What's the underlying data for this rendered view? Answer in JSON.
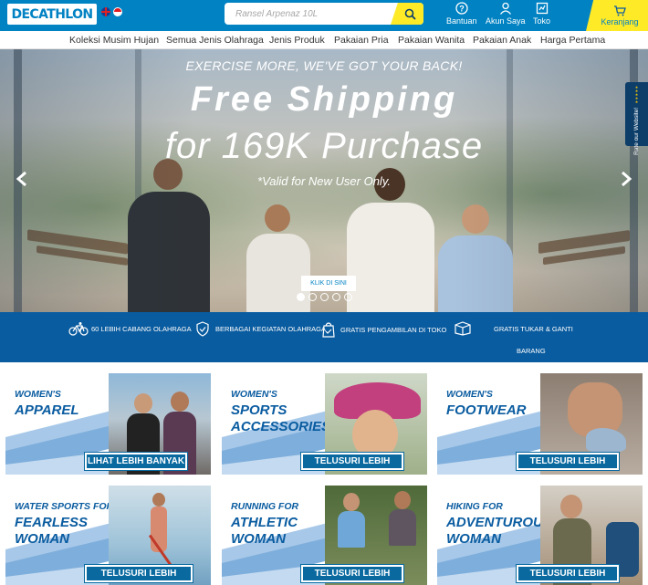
{
  "header": {
    "logo_text": "DECATHLON",
    "search_placeholder": "Ransel Arpenaz 10L",
    "help_label": "Bantuan",
    "account_label": "Akun Saya",
    "store_label": "Toko",
    "cart_label": "Keranjang",
    "colors": {
      "brand": "#0082c3",
      "accent": "#ffea28"
    }
  },
  "nav": {
    "items": [
      "Koleksi Musim Hujan",
      "Semua Jenis Olahraga",
      "Jenis Produk",
      "Pakaian Pria",
      "Pakaian Wanita",
      "Pakaian Anak",
      "Harga Pertama"
    ]
  },
  "hero": {
    "tagline": "EXERCISE MORE, WE'VE GOT YOUR BACK!",
    "title_line1": "Free Shipping",
    "title_line2": "for 169K Purchase",
    "note": "*Valid for New User Only.",
    "cta_label": "KLIK DI SINI",
    "slide_count": 5,
    "active_slide": 1,
    "rate_widget_label": "Rate our Website!"
  },
  "features": [
    {
      "icon": "bike-icon",
      "text": "60 LEBIH CABANG OLAHRAGA"
    },
    {
      "icon": "shield-icon",
      "text": "BERBAGAI KEGIATAN OLAHRAGA"
    },
    {
      "icon": "store-pickup-icon",
      "text": "GRATIS PENGAMBILAN DI TOKO"
    },
    {
      "icon": "box-return-icon",
      "text": "GRATIS TUKAR & GANTI",
      "text2": "BARANG"
    }
  ],
  "tiles": [
    {
      "line1": "WOMEN'S",
      "line2": "APPAREL",
      "line3": "",
      "button": "LIHAT LEBIH BANYAK"
    },
    {
      "line1": "WOMEN'S",
      "line2": "SPORTS",
      "line3": "ACCESSORIES",
      "button": "TELUSURI LEBIH"
    },
    {
      "line1": "WOMEN'S",
      "line2": "FOOTWEAR",
      "line3": "",
      "button": "TELUSURI LEBIH"
    },
    {
      "line1": "WATER SPORTS FOR",
      "line2": "FEARLESS",
      "line3": "WOMAN",
      "button": "TELUSURI LEBIH"
    },
    {
      "line1": "RUNNING FOR",
      "line2": "ATHLETIC",
      "line3": "WOMAN",
      "button": "TELUSURI LEBIH"
    },
    {
      "line1": "HIKING FOR",
      "line2": "ADVENTUROUS",
      "line3": "WOMAN",
      "button": "TELUSURI LEBIH"
    }
  ]
}
